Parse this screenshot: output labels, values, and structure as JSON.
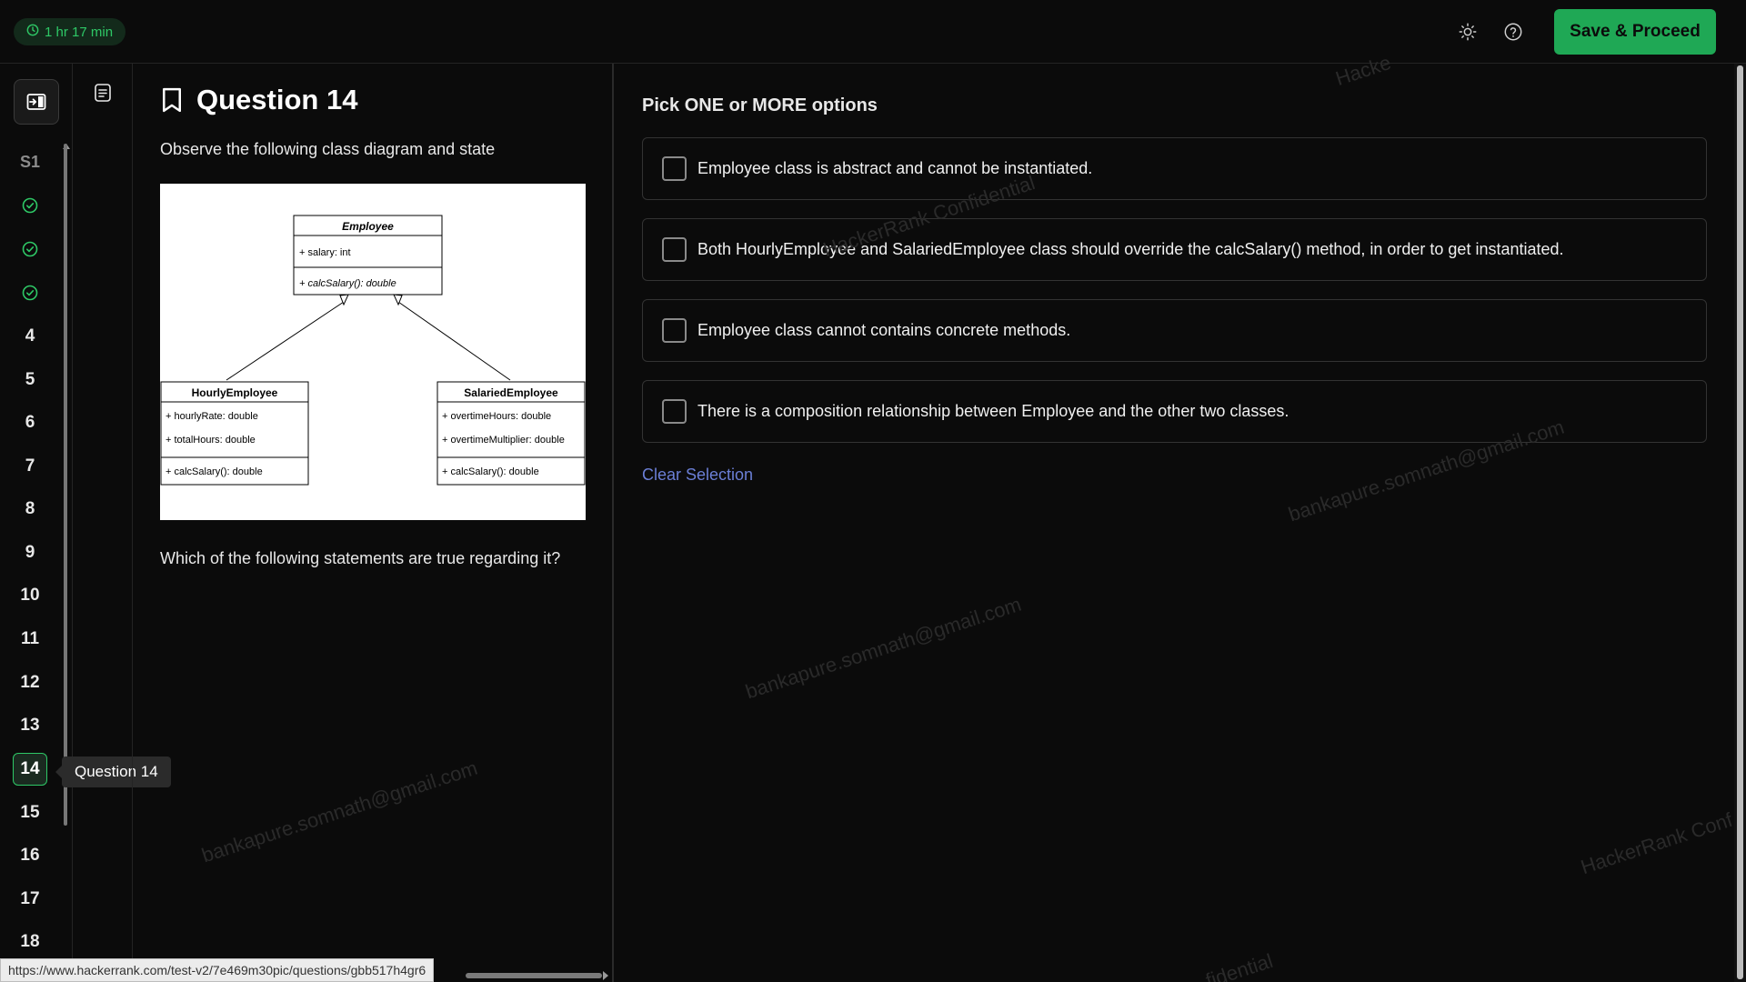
{
  "header": {
    "timer": "1 hr 17 min",
    "theme_icon": "sun-icon",
    "help_icon": "help-circle-icon",
    "save_label": "Save & Proceed"
  },
  "nav": {
    "toggle_icon": "sidebar-toggle-icon",
    "section_label": "S1",
    "completed_icon": "check-circle-icon",
    "questions": [
      "4",
      "5",
      "6",
      "7",
      "8",
      "9",
      "10",
      "11",
      "12",
      "13",
      "14",
      "15",
      "16",
      "17",
      "18"
    ],
    "active": "14",
    "tooltip": "Question 14"
  },
  "side": {
    "doc_icon": "document-icon"
  },
  "question": {
    "bookmark_icon": "bookmark-icon",
    "title": "Question 14",
    "prompt": "Observe the following class diagram and state",
    "follow_up": "Which of the following statements are true regarding it?",
    "diagram": {
      "employee": {
        "name": "Employee",
        "attr": "+ salary: int",
        "method": "+ calcSalary(): double"
      },
      "hourly": {
        "name": "HourlyEmployee",
        "attr1": "+ hourlyRate: double",
        "attr2": "+ totalHours: double",
        "method": "+ calcSalary(): double"
      },
      "salaried": {
        "name": "SalariedEmployee",
        "attr1": "+ overtimeHours: double",
        "attr2": "+ overtimeMultiplier: double",
        "method": "+ calcSalary(): double"
      }
    }
  },
  "options": {
    "header": "Pick ONE or MORE options",
    "items": [
      "Employee class is abstract and cannot be instantiated.",
      "Both HourlyEmployee and SalariedEmployee class should override the calcSalary() method, in order to get instantiated.",
      "Employee class cannot contains concrete methods.",
      "There is a composition relationship between Employee and the other two classes."
    ],
    "clear_label": "Clear Selection"
  },
  "watermarks": {
    "email": "bankapure.somnath@gmail.com",
    "confidential": "HackerRank Confidential",
    "confidential_short": "fidential",
    "hacker_short": "Hacke",
    "hackerrank_conf": "HackerRank Conf"
  },
  "status_url": "https://www.hackerrank.com/test-v2/7e469m30pic/questions/gbb517h4gr6",
  "colors": {
    "accent": "#1fa855",
    "link": "#6b7fd6",
    "background": "#0b0b0b"
  }
}
